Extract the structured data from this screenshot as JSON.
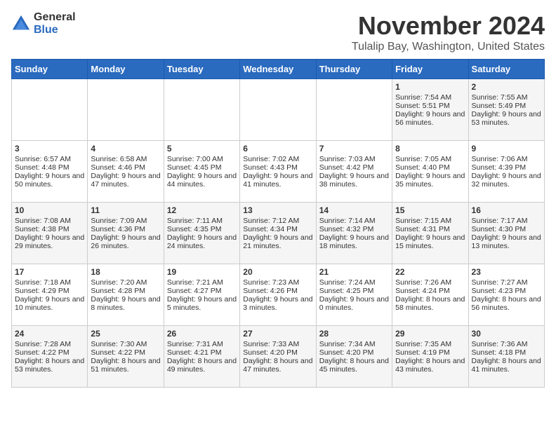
{
  "header": {
    "logo_general": "General",
    "logo_blue": "Blue",
    "month_title": "November 2024",
    "location": "Tulalip Bay, Washington, United States"
  },
  "days_of_week": [
    "Sunday",
    "Monday",
    "Tuesday",
    "Wednesday",
    "Thursday",
    "Friday",
    "Saturday"
  ],
  "weeks": [
    [
      {
        "day": "",
        "info": ""
      },
      {
        "day": "",
        "info": ""
      },
      {
        "day": "",
        "info": ""
      },
      {
        "day": "",
        "info": ""
      },
      {
        "day": "",
        "info": ""
      },
      {
        "day": "1",
        "info": "Sunrise: 7:54 AM\nSunset: 5:51 PM\nDaylight: 9 hours and 56 minutes."
      },
      {
        "day": "2",
        "info": "Sunrise: 7:55 AM\nSunset: 5:49 PM\nDaylight: 9 hours and 53 minutes."
      }
    ],
    [
      {
        "day": "3",
        "info": "Sunrise: 6:57 AM\nSunset: 4:48 PM\nDaylight: 9 hours and 50 minutes."
      },
      {
        "day": "4",
        "info": "Sunrise: 6:58 AM\nSunset: 4:46 PM\nDaylight: 9 hours and 47 minutes."
      },
      {
        "day": "5",
        "info": "Sunrise: 7:00 AM\nSunset: 4:45 PM\nDaylight: 9 hours and 44 minutes."
      },
      {
        "day": "6",
        "info": "Sunrise: 7:02 AM\nSunset: 4:43 PM\nDaylight: 9 hours and 41 minutes."
      },
      {
        "day": "7",
        "info": "Sunrise: 7:03 AM\nSunset: 4:42 PM\nDaylight: 9 hours and 38 minutes."
      },
      {
        "day": "8",
        "info": "Sunrise: 7:05 AM\nSunset: 4:40 PM\nDaylight: 9 hours and 35 minutes."
      },
      {
        "day": "9",
        "info": "Sunrise: 7:06 AM\nSunset: 4:39 PM\nDaylight: 9 hours and 32 minutes."
      }
    ],
    [
      {
        "day": "10",
        "info": "Sunrise: 7:08 AM\nSunset: 4:38 PM\nDaylight: 9 hours and 29 minutes."
      },
      {
        "day": "11",
        "info": "Sunrise: 7:09 AM\nSunset: 4:36 PM\nDaylight: 9 hours and 26 minutes."
      },
      {
        "day": "12",
        "info": "Sunrise: 7:11 AM\nSunset: 4:35 PM\nDaylight: 9 hours and 24 minutes."
      },
      {
        "day": "13",
        "info": "Sunrise: 7:12 AM\nSunset: 4:34 PM\nDaylight: 9 hours and 21 minutes."
      },
      {
        "day": "14",
        "info": "Sunrise: 7:14 AM\nSunset: 4:32 PM\nDaylight: 9 hours and 18 minutes."
      },
      {
        "day": "15",
        "info": "Sunrise: 7:15 AM\nSunset: 4:31 PM\nDaylight: 9 hours and 15 minutes."
      },
      {
        "day": "16",
        "info": "Sunrise: 7:17 AM\nSunset: 4:30 PM\nDaylight: 9 hours and 13 minutes."
      }
    ],
    [
      {
        "day": "17",
        "info": "Sunrise: 7:18 AM\nSunset: 4:29 PM\nDaylight: 9 hours and 10 minutes."
      },
      {
        "day": "18",
        "info": "Sunrise: 7:20 AM\nSunset: 4:28 PM\nDaylight: 9 hours and 8 minutes."
      },
      {
        "day": "19",
        "info": "Sunrise: 7:21 AM\nSunset: 4:27 PM\nDaylight: 9 hours and 5 minutes."
      },
      {
        "day": "20",
        "info": "Sunrise: 7:23 AM\nSunset: 4:26 PM\nDaylight: 9 hours and 3 minutes."
      },
      {
        "day": "21",
        "info": "Sunrise: 7:24 AM\nSunset: 4:25 PM\nDaylight: 9 hours and 0 minutes."
      },
      {
        "day": "22",
        "info": "Sunrise: 7:26 AM\nSunset: 4:24 PM\nDaylight: 8 hours and 58 minutes."
      },
      {
        "day": "23",
        "info": "Sunrise: 7:27 AM\nSunset: 4:23 PM\nDaylight: 8 hours and 56 minutes."
      }
    ],
    [
      {
        "day": "24",
        "info": "Sunrise: 7:28 AM\nSunset: 4:22 PM\nDaylight: 8 hours and 53 minutes."
      },
      {
        "day": "25",
        "info": "Sunrise: 7:30 AM\nSunset: 4:22 PM\nDaylight: 8 hours and 51 minutes."
      },
      {
        "day": "26",
        "info": "Sunrise: 7:31 AM\nSunset: 4:21 PM\nDaylight: 8 hours and 49 minutes."
      },
      {
        "day": "27",
        "info": "Sunrise: 7:33 AM\nSunset: 4:20 PM\nDaylight: 8 hours and 47 minutes."
      },
      {
        "day": "28",
        "info": "Sunrise: 7:34 AM\nSunset: 4:20 PM\nDaylight: 8 hours and 45 minutes."
      },
      {
        "day": "29",
        "info": "Sunrise: 7:35 AM\nSunset: 4:19 PM\nDaylight: 8 hours and 43 minutes."
      },
      {
        "day": "30",
        "info": "Sunrise: 7:36 AM\nSunset: 4:18 PM\nDaylight: 8 hours and 41 minutes."
      }
    ]
  ]
}
